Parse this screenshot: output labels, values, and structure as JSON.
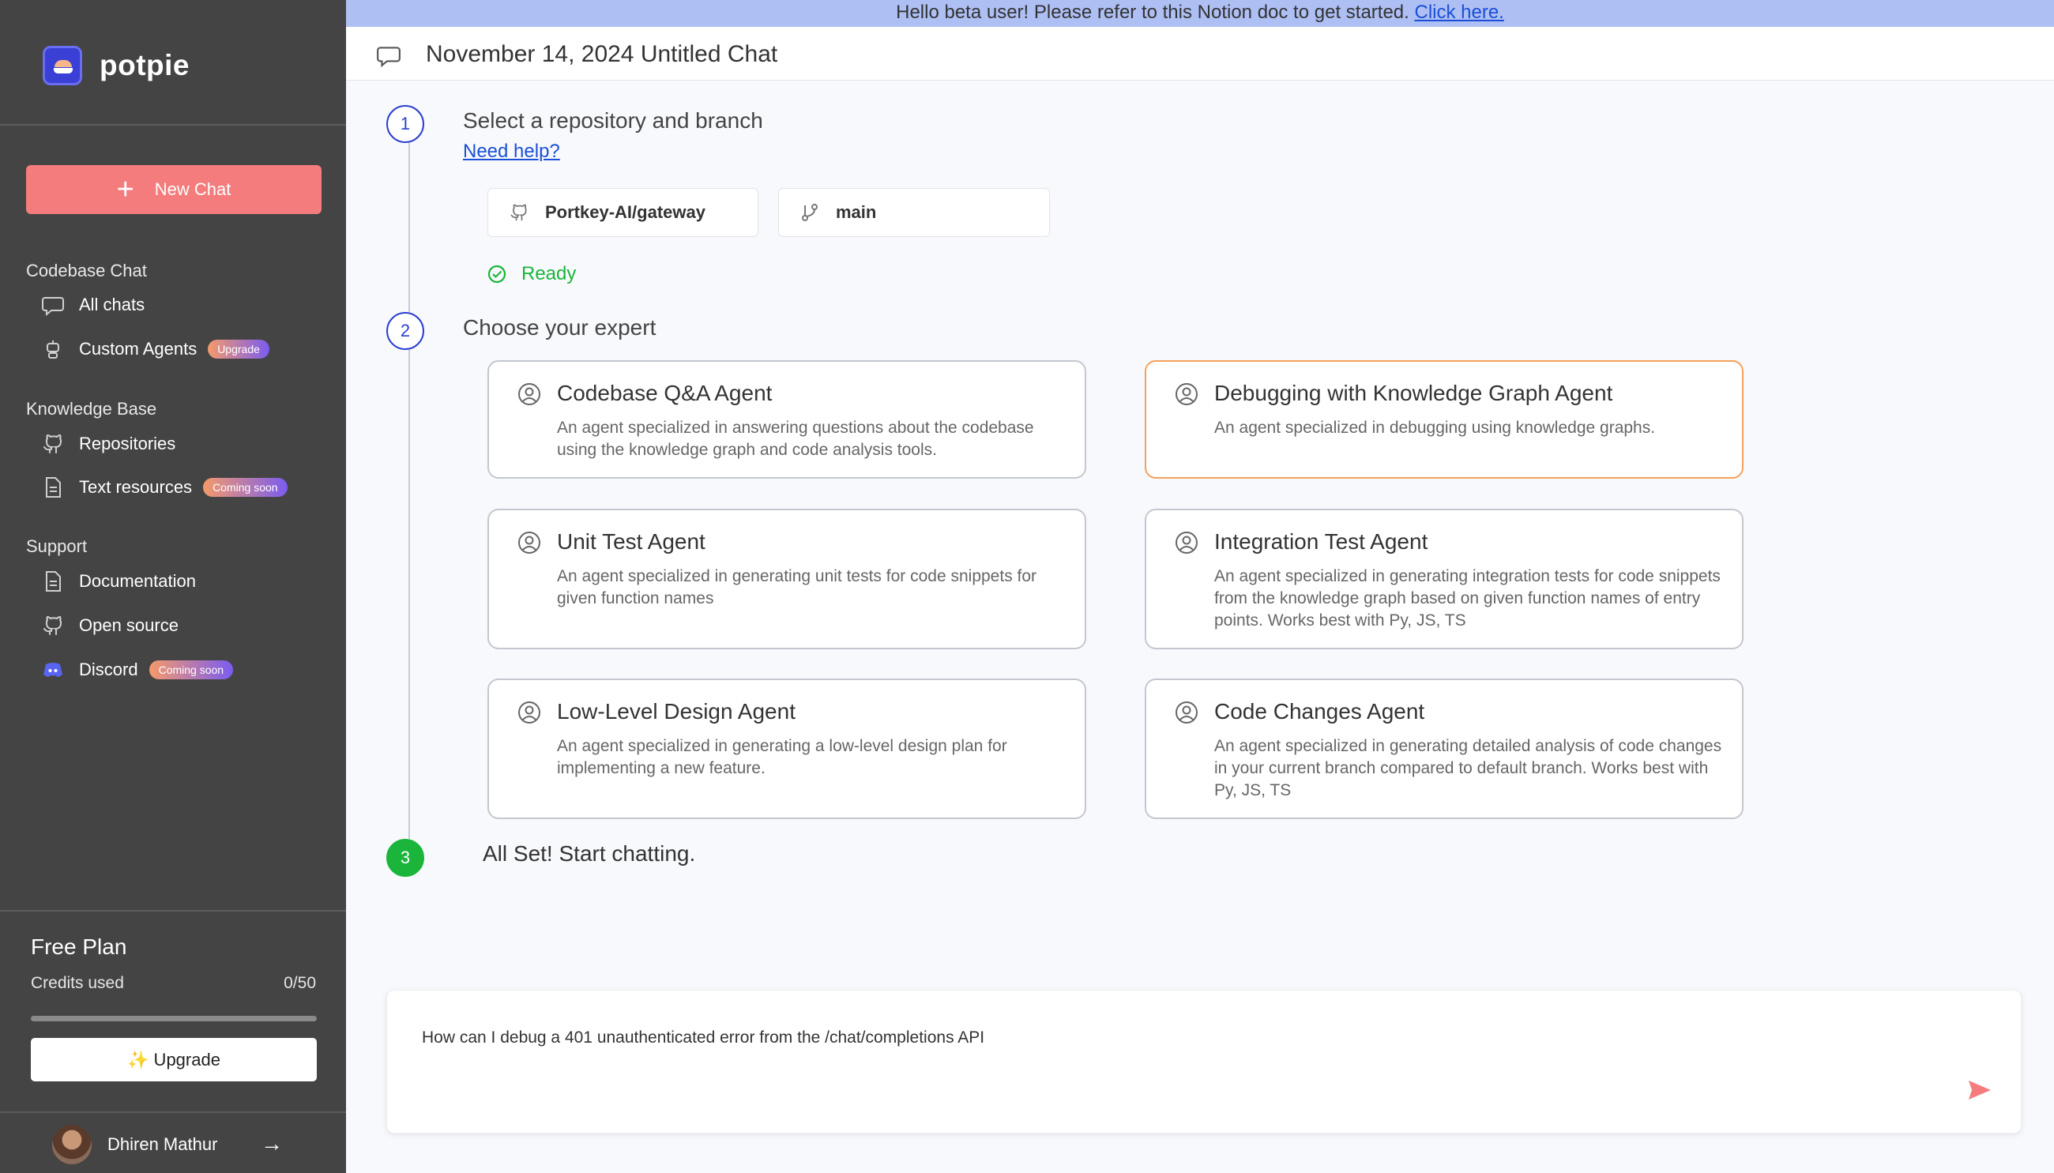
{
  "banner": {
    "text": "Hello beta user! Please refer to this Notion doc to get started.",
    "link": "Click here."
  },
  "sidebar": {
    "brand": "potpie",
    "new_chat": "New Chat",
    "sections": {
      "codebase": "Codebase Chat",
      "knowledge": "Knowledge Base",
      "support": "Support"
    },
    "items": {
      "all_chats": "All chats",
      "custom_agents": "Custom Agents",
      "custom_agents_badge": "Upgrade",
      "repositories": "Repositories",
      "text_resources": "Text resources",
      "text_resources_badge": "Coming soon",
      "documentation": "Documentation",
      "open_source": "Open source",
      "discord": "Discord",
      "discord_badge": "Coming soon"
    },
    "plan": {
      "title": "Free Plan",
      "credits_label": "Credits used",
      "credits_value": "0/50",
      "credits_used_fraction": 0,
      "upgrade": "✨ Upgrade"
    },
    "user": {
      "name": "Dhiren Mathur"
    }
  },
  "header": {
    "title": "November 14, 2024 Untitled Chat"
  },
  "steps": {
    "one": {
      "number": "1",
      "title": "Select a repository and branch",
      "help": "Need help?"
    },
    "two": {
      "number": "2",
      "title": "Choose your expert"
    },
    "three": {
      "number": "3",
      "title": "All Set! Start chatting."
    }
  },
  "repo": {
    "repository": "Portkey-AI/gateway",
    "branch": "main",
    "status": "Ready"
  },
  "agents": [
    {
      "title": "Codebase Q&A Agent",
      "desc": "An agent specialized in answering questions about the codebase using the knowledge graph and code analysis tools."
    },
    {
      "title": "Debugging with Knowledge Graph Agent",
      "desc": "An agent specialized in debugging using knowledge graphs."
    },
    {
      "title": "Unit Test Agent",
      "desc": "An agent specialized in generating unit tests for code snippets for given function names"
    },
    {
      "title": "Integration Test Agent",
      "desc": "An agent specialized in generating integration tests for code snippets from the knowledge graph based on given function names of entry points. Works best with Py, JS, TS"
    },
    {
      "title": "Low-Level Design Agent",
      "desc": "An agent specialized in generating a low-level design plan for implementing a new feature."
    },
    {
      "title": "Code Changes Agent",
      "desc": "An agent specialized in generating detailed analysis of code changes in your current branch compared to default branch. Works best with Py, JS, TS"
    }
  ],
  "chat": {
    "message": "How can I debug a 401 unauthenticated error from the /chat/completions API"
  },
  "colors": {
    "accent": "#f47c7c",
    "selected_border": "#f5a15b",
    "step_blue": "#2b3fd0",
    "success": "#1ab53a"
  }
}
